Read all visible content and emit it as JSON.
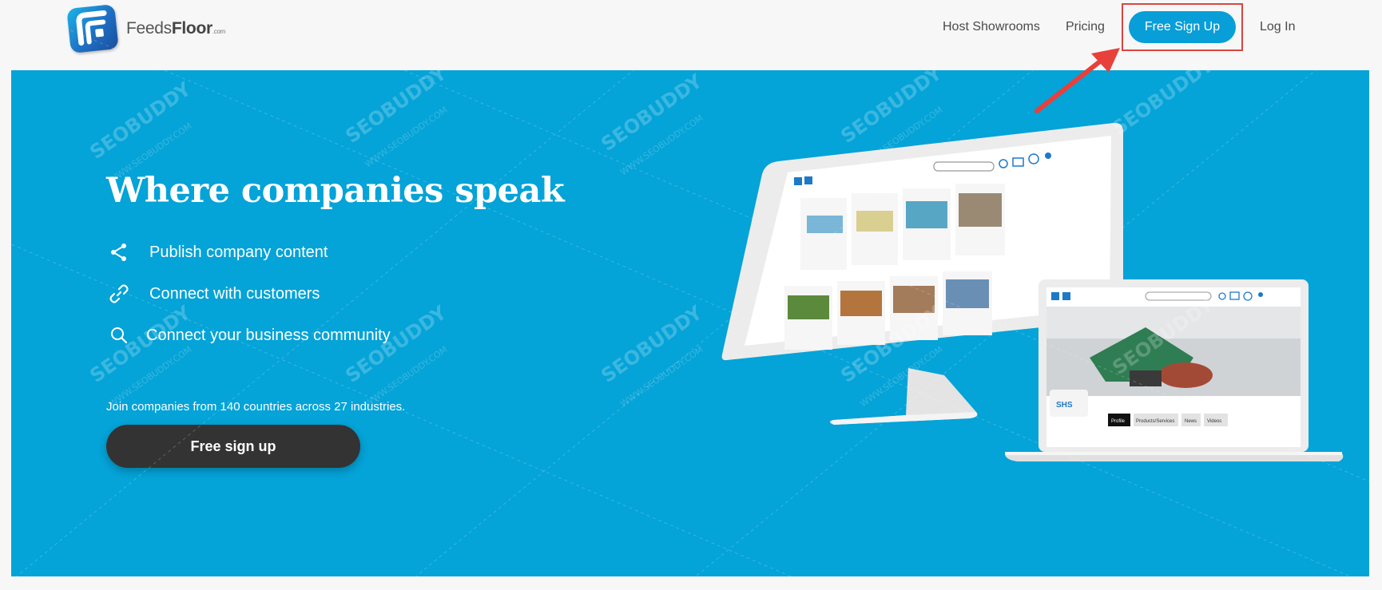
{
  "brand": {
    "name_regular": "Feeds",
    "name_bold": "Floor",
    "suffix": ".com"
  },
  "nav": {
    "host_showrooms": "Host Showrooms",
    "pricing": "Pricing",
    "free_sign_up": "Free Sign Up",
    "log_in": "Log In"
  },
  "hero": {
    "title": "Where companies speak",
    "features": [
      {
        "icon": "share-icon",
        "label": "Publish company content"
      },
      {
        "icon": "link-icon",
        "label": "Connect with customers"
      },
      {
        "icon": "search-icon",
        "label": "Connect your business community"
      }
    ],
    "join_text": "Join companies from 140 countries across 27 industries.",
    "cta_label": "Free sign up"
  },
  "laptop_screen": {
    "company_badge": "SHS",
    "tabs": [
      "Profile",
      "Products/Services",
      "News",
      "Videos"
    ]
  },
  "watermark": {
    "text": "SEOBUDDY",
    "url": "WWW.SEOBUDDY.COM"
  },
  "colors": {
    "hero_bg": "#04a3d8",
    "accent_button": "#089ed8",
    "cta_bg": "#333333",
    "highlight_box": "#d9453f",
    "arrow": "#e8403a"
  }
}
